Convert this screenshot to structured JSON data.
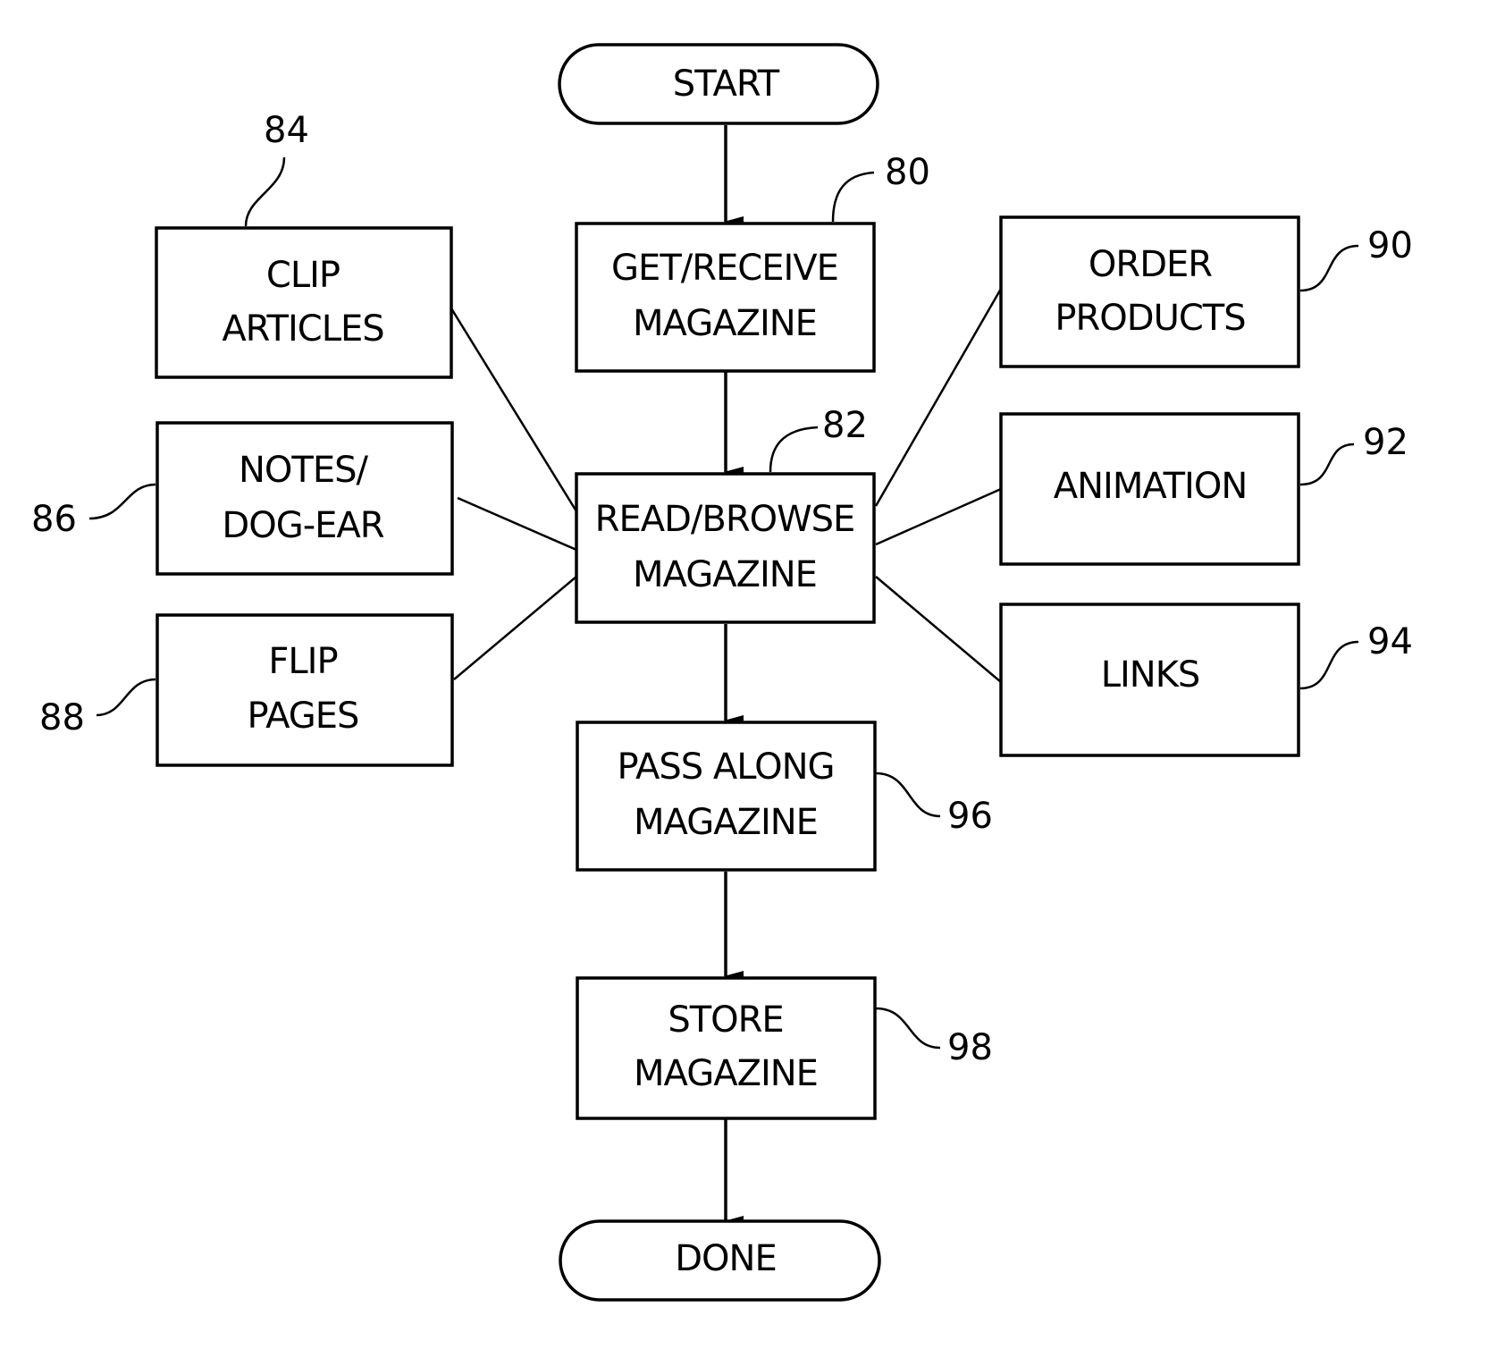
{
  "diagram": {
    "terminals": {
      "start": {
        "label": "START"
      },
      "done": {
        "label": "DONE"
      }
    },
    "main_steps": [
      {
        "id": "80",
        "lines": [
          "GET/RECEIVE",
          "MAGAZINE"
        ]
      },
      {
        "id": "82",
        "lines": [
          "READ/BROWSE",
          "MAGAZINE"
        ]
      },
      {
        "id": "96",
        "lines": [
          "PASS ALONG",
          "MAGAZINE"
        ]
      },
      {
        "id": "98",
        "lines": [
          "STORE",
          "MAGAZINE"
        ]
      }
    ],
    "left_options": [
      {
        "id": "84",
        "lines": [
          "CLIP",
          "ARTICLES"
        ]
      },
      {
        "id": "86",
        "lines": [
          "NOTES/",
          "DOG-EAR"
        ]
      },
      {
        "id": "88",
        "lines": [
          "FLIP",
          "PAGES"
        ]
      }
    ],
    "right_options": [
      {
        "id": "90",
        "lines": [
          "ORDER",
          "PRODUCTS"
        ]
      },
      {
        "id": "92",
        "lines": [
          "ANIMATION"
        ]
      },
      {
        "id": "94",
        "lines": [
          "LINKS"
        ]
      }
    ],
    "ref_labels": [
      "80",
      "82",
      "84",
      "86",
      "88",
      "90",
      "92",
      "94",
      "96",
      "98"
    ]
  }
}
